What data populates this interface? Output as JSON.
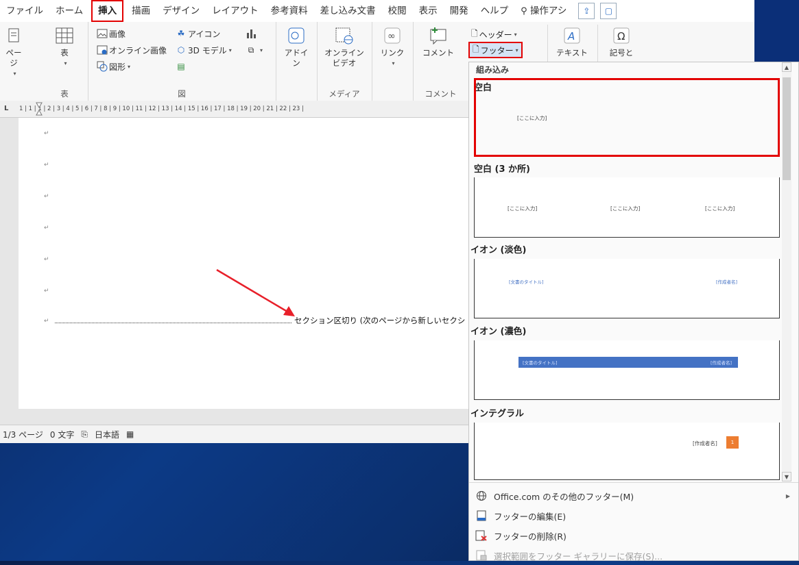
{
  "tabs": [
    {
      "label": "ファイル"
    },
    {
      "label": "ホーム"
    },
    {
      "label": "挿入",
      "active": true
    },
    {
      "label": "描画"
    },
    {
      "label": "デザイン"
    },
    {
      "label": "レイアウト"
    },
    {
      "label": "参考資料"
    },
    {
      "label": "差し込み文書"
    },
    {
      "label": "校閲"
    },
    {
      "label": "表示"
    },
    {
      "label": "開発"
    },
    {
      "label": "ヘルプ"
    },
    {
      "label": "操作アシ"
    }
  ],
  "ribbon": {
    "pages_label": "ページ",
    "table_label": "表",
    "table_group": "表",
    "image_label": "画像",
    "online_image_label": "オンライン画像",
    "shapes_label": "図形",
    "icons_label": "アイコン",
    "model3d_label": "3D モデル",
    "figure_group": "図",
    "addins_label": "アドイン",
    "online_video_label": "オンライン ビデオ",
    "media_group": "メディア",
    "link_label": "リンク",
    "comment_label": "コメント",
    "comment_group": "コメント",
    "header_label": "ヘッダー",
    "footer_label": "フッター",
    "text_label": "テキスト",
    "symbol_label": "記号と"
  },
  "ruler": {
    "corner": "L",
    "numbers": "1 | 1 | 1 | 2 | 3 | 4 | 5 | 6 | 7 | 8 | 9 | 10 | 11 | 12 | 13 | 14 | 15 | 16 | 17 | 18 | 19 | 20 | 21 | 22 | 23 |"
  },
  "document": {
    "paragraph_mark": "↵",
    "section_break": "セクション区切り (次のページから新しいセクシ"
  },
  "status": {
    "page": "1/3 ページ",
    "words": "0 文字",
    "language": "日本語"
  },
  "gallery": {
    "header": "組み込み",
    "items": [
      {
        "title": "空白",
        "placeholders": [
          "[ここに入力]"
        ]
      },
      {
        "title": "空白 (3 か所)",
        "placeholders": [
          "[ここに入力]",
          "[ここに入力]",
          "[ここに入力]"
        ]
      },
      {
        "title": "イオン (淡色)",
        "placeholders": [
          "[文書のタイトル]",
          "[作成者名]"
        ]
      },
      {
        "title": "イオン (濃色)",
        "placeholders": [
          "[文書のタイトル]",
          "[作成者名]"
        ]
      },
      {
        "title": "インテグラル",
        "placeholders": [
          "[作成者名]",
          "1"
        ]
      }
    ],
    "menu": [
      {
        "label": "Office.com のその他のフッター(M)",
        "icon": "globe-icon",
        "enabled": true
      },
      {
        "label": "フッターの編集(E)",
        "icon": "edit-footer-icon",
        "enabled": true
      },
      {
        "label": "フッターの削除(R)",
        "icon": "delete-footer-icon",
        "enabled": true
      },
      {
        "label": "選択範囲をフッター ギャラリーに保存(S)...",
        "icon": "save-gallery-icon",
        "enabled": false
      }
    ]
  },
  "colors": {
    "highlight": "#e30000",
    "ion_dark_bar": "#4472c4",
    "integral_accent": "#ed7d31",
    "desktop": "#0c3a86"
  }
}
